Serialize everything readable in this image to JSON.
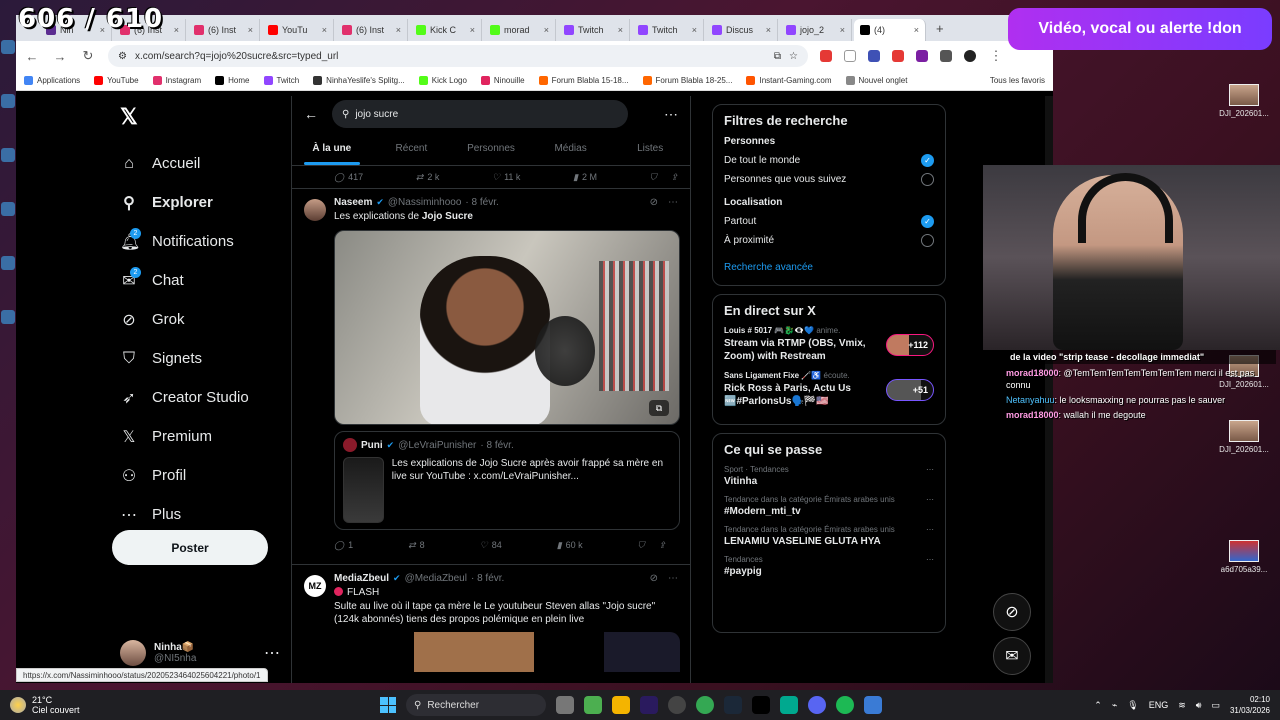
{
  "overlay": {
    "sub_count": "606 / 610",
    "don_banner": "Vidéo, vocal ou alerte !don",
    "chat_lines": [
      {
        "user": "",
        "text": "de la video \"strip tease - decollage immediat\""
      },
      {
        "user": "morad18000",
        "text": ": @TemTemTemTemTemTemTem merci il est pas connu"
      },
      {
        "user": "Netanyahuu",
        "text": ": le looksmaxxing ne pourras pas le sauver"
      },
      {
        "user": "morad18000",
        "text": ": wallah il me degoute"
      }
    ],
    "desktop_files": [
      "DJI_202601...",
      "DJI_202601...",
      "DJI_202601...",
      "a6d705a39..."
    ]
  },
  "browser": {
    "tabs": [
      {
        "label": "Nin",
        "color": "#5c2d91"
      },
      {
        "label": "(6) Inst",
        "color": "#e1306c"
      },
      {
        "label": "(6) Inst",
        "color": "#e1306c"
      },
      {
        "label": "YouTu",
        "color": "#ff0000"
      },
      {
        "label": "(6) Inst",
        "color": "#e1306c"
      },
      {
        "label": "Kick C",
        "color": "#53fc18"
      },
      {
        "label": "morad",
        "color": "#53fc18"
      },
      {
        "label": "Twitch",
        "color": "#9146ff"
      },
      {
        "label": "Twitch",
        "color": "#9146ff"
      },
      {
        "label": "Discus",
        "color": "#9146ff"
      },
      {
        "label": "jojo_2",
        "color": "#9146ff"
      },
      {
        "label": "(4)",
        "color": "#000000"
      }
    ],
    "url": "x.com/search?q=jojo%20sucre&src=typed_url",
    "bookmarks": [
      {
        "label": "Applications",
        "color": "#4285f4"
      },
      {
        "label": "YouTube",
        "color": "#ff0000"
      },
      {
        "label": "Instagram",
        "color": "#e1306c"
      },
      {
        "label": "Home",
        "color": "#000000"
      },
      {
        "label": "Twitch",
        "color": "#9146ff"
      },
      {
        "label": "NinhaYeslife's Splitg...",
        "color": "#333333"
      },
      {
        "label": "Kick Logo",
        "color": "#53fc18"
      },
      {
        "label": "Ninouille",
        "color": "#e0245e"
      },
      {
        "label": "Forum Blabla 15-18...",
        "color": "#ff6600"
      },
      {
        "label": "Forum Blabla 18-25...",
        "color": "#ff6600"
      },
      {
        "label": "Instant-Gaming.com",
        "color": "#ff5400"
      },
      {
        "label": "Nouvel onglet",
        "color": "#888888"
      }
    ],
    "all_bookmarks": "Tous les favoris",
    "status_url": "https://x.com/Nassiminhooo/status/2020523464025604221/photo/1"
  },
  "nav": {
    "items": [
      {
        "label": "Accueil",
        "icon": "home-icon",
        "glyph": "⌂",
        "bold": false,
        "badge": ""
      },
      {
        "label": "Explorer",
        "icon": "search-icon",
        "glyph": "⚲",
        "bold": true,
        "badge": ""
      },
      {
        "label": "Notifications",
        "icon": "bell-icon",
        "glyph": "🔔︎",
        "bold": false,
        "badge": "2"
      },
      {
        "label": "Chat",
        "icon": "chat-icon",
        "glyph": "✉",
        "bold": false,
        "badge": "2"
      },
      {
        "label": "Grok",
        "icon": "grok-icon",
        "glyph": "⊘",
        "bold": false,
        "badge": ""
      },
      {
        "label": "Signets",
        "icon": "bookmark-icon",
        "glyph": "⛉",
        "bold": false,
        "badge": ""
      },
      {
        "label": "Creator Studio",
        "icon": "rocket-icon",
        "glyph": "➶",
        "bold": false,
        "badge": ""
      },
      {
        "label": "Premium",
        "icon": "x-premium-icon",
        "glyph": "𝕏",
        "bold": false,
        "badge": ""
      },
      {
        "label": "Profil",
        "icon": "person-icon",
        "glyph": "⚇",
        "bold": false,
        "badge": ""
      },
      {
        "label": "Plus",
        "icon": "more-circle-icon",
        "glyph": "⋯",
        "bold": false,
        "badge": ""
      }
    ],
    "post_label": "Poster",
    "profile_name": "Ninha📦",
    "profile_handle": "@NI5nha"
  },
  "search": {
    "query": "jojo sucre",
    "tabs": [
      "À la une",
      "Récent",
      "Personnes",
      "Médias",
      "Listes"
    ]
  },
  "top_actions": {
    "replies": "417",
    "reposts": "2 k",
    "likes": "11 k",
    "views": "2 M"
  },
  "tweet1": {
    "name": "Naseem",
    "handle": "@Nassiminhooo",
    "date": "· 8 févr.",
    "text_pre": "Les explications de ",
    "text_bold": "Jojo Sucre",
    "quote_name": "Puni",
    "quote_handle": "@LeVraiPunisher",
    "quote_date": "· 8 févr.",
    "quote_text": "Les explications de Jojo Sucre après avoir frappé sa mère en live sur YouTube : x.com/LeVraiPunisher...",
    "replies": "1",
    "reposts": "8",
    "likes": "84",
    "views": "60 k"
  },
  "tweet2": {
    "name": "MediaZbeul",
    "handle": "@MediaZbeul",
    "date": "· 8 févr.",
    "avatar_text": "MZ",
    "flash": "FLASH",
    "text": "Sulte au live où il tape ça mère le Le youtubeur Steven allas \"Jojo sucre\" (124k abonnés) tiens des propos polémique en plein live"
  },
  "filters": {
    "title": "Filtres de recherche",
    "people_title": "Personnes",
    "people_opts": [
      {
        "label": "De tout le monde",
        "on": true
      },
      {
        "label": "Personnes que vous suivez",
        "on": false
      }
    ],
    "loc_title": "Localisation",
    "loc_opts": [
      {
        "label": "Partout",
        "on": true
      },
      {
        "label": "À proximité",
        "on": false
      }
    ],
    "advanced": "Recherche avancée"
  },
  "live": {
    "title": "En direct sur X",
    "items": [
      {
        "host": "Louis # 5017 🎮🐉👁‍🗨💙",
        "action": "anime.",
        "title": "Stream via RTMP (OBS, Vmix, Zoom) with Restream",
        "count": "+112"
      },
      {
        "host": "Sans Ligament Fixe 🦯♿",
        "action": "écoute.",
        "title": "Rick Ross à Paris, Actu Us 🆕#ParlonsUs🗣️🏁🇺🇸",
        "count": "+51"
      }
    ]
  },
  "trends": {
    "title": "Ce qui se passe",
    "items": [
      {
        "cat": "Sport · Tendances",
        "name": "Vitinha"
      },
      {
        "cat": "Tendance dans la catégorie Émirats arabes unis",
        "name": "#Modern_mti_tv"
      },
      {
        "cat": "Tendance dans la catégorie Émirats arabes unis",
        "name": "LENAMIU VASELINE GLUTA HYA"
      },
      {
        "cat": "Tendances",
        "name": "#paypig"
      }
    ]
  },
  "taskbar": {
    "temp": "21°C",
    "weather": "Ciel couvert",
    "search": "Rechercher",
    "lang": "ENG",
    "time": "02:10",
    "date": "31/03/2026"
  }
}
